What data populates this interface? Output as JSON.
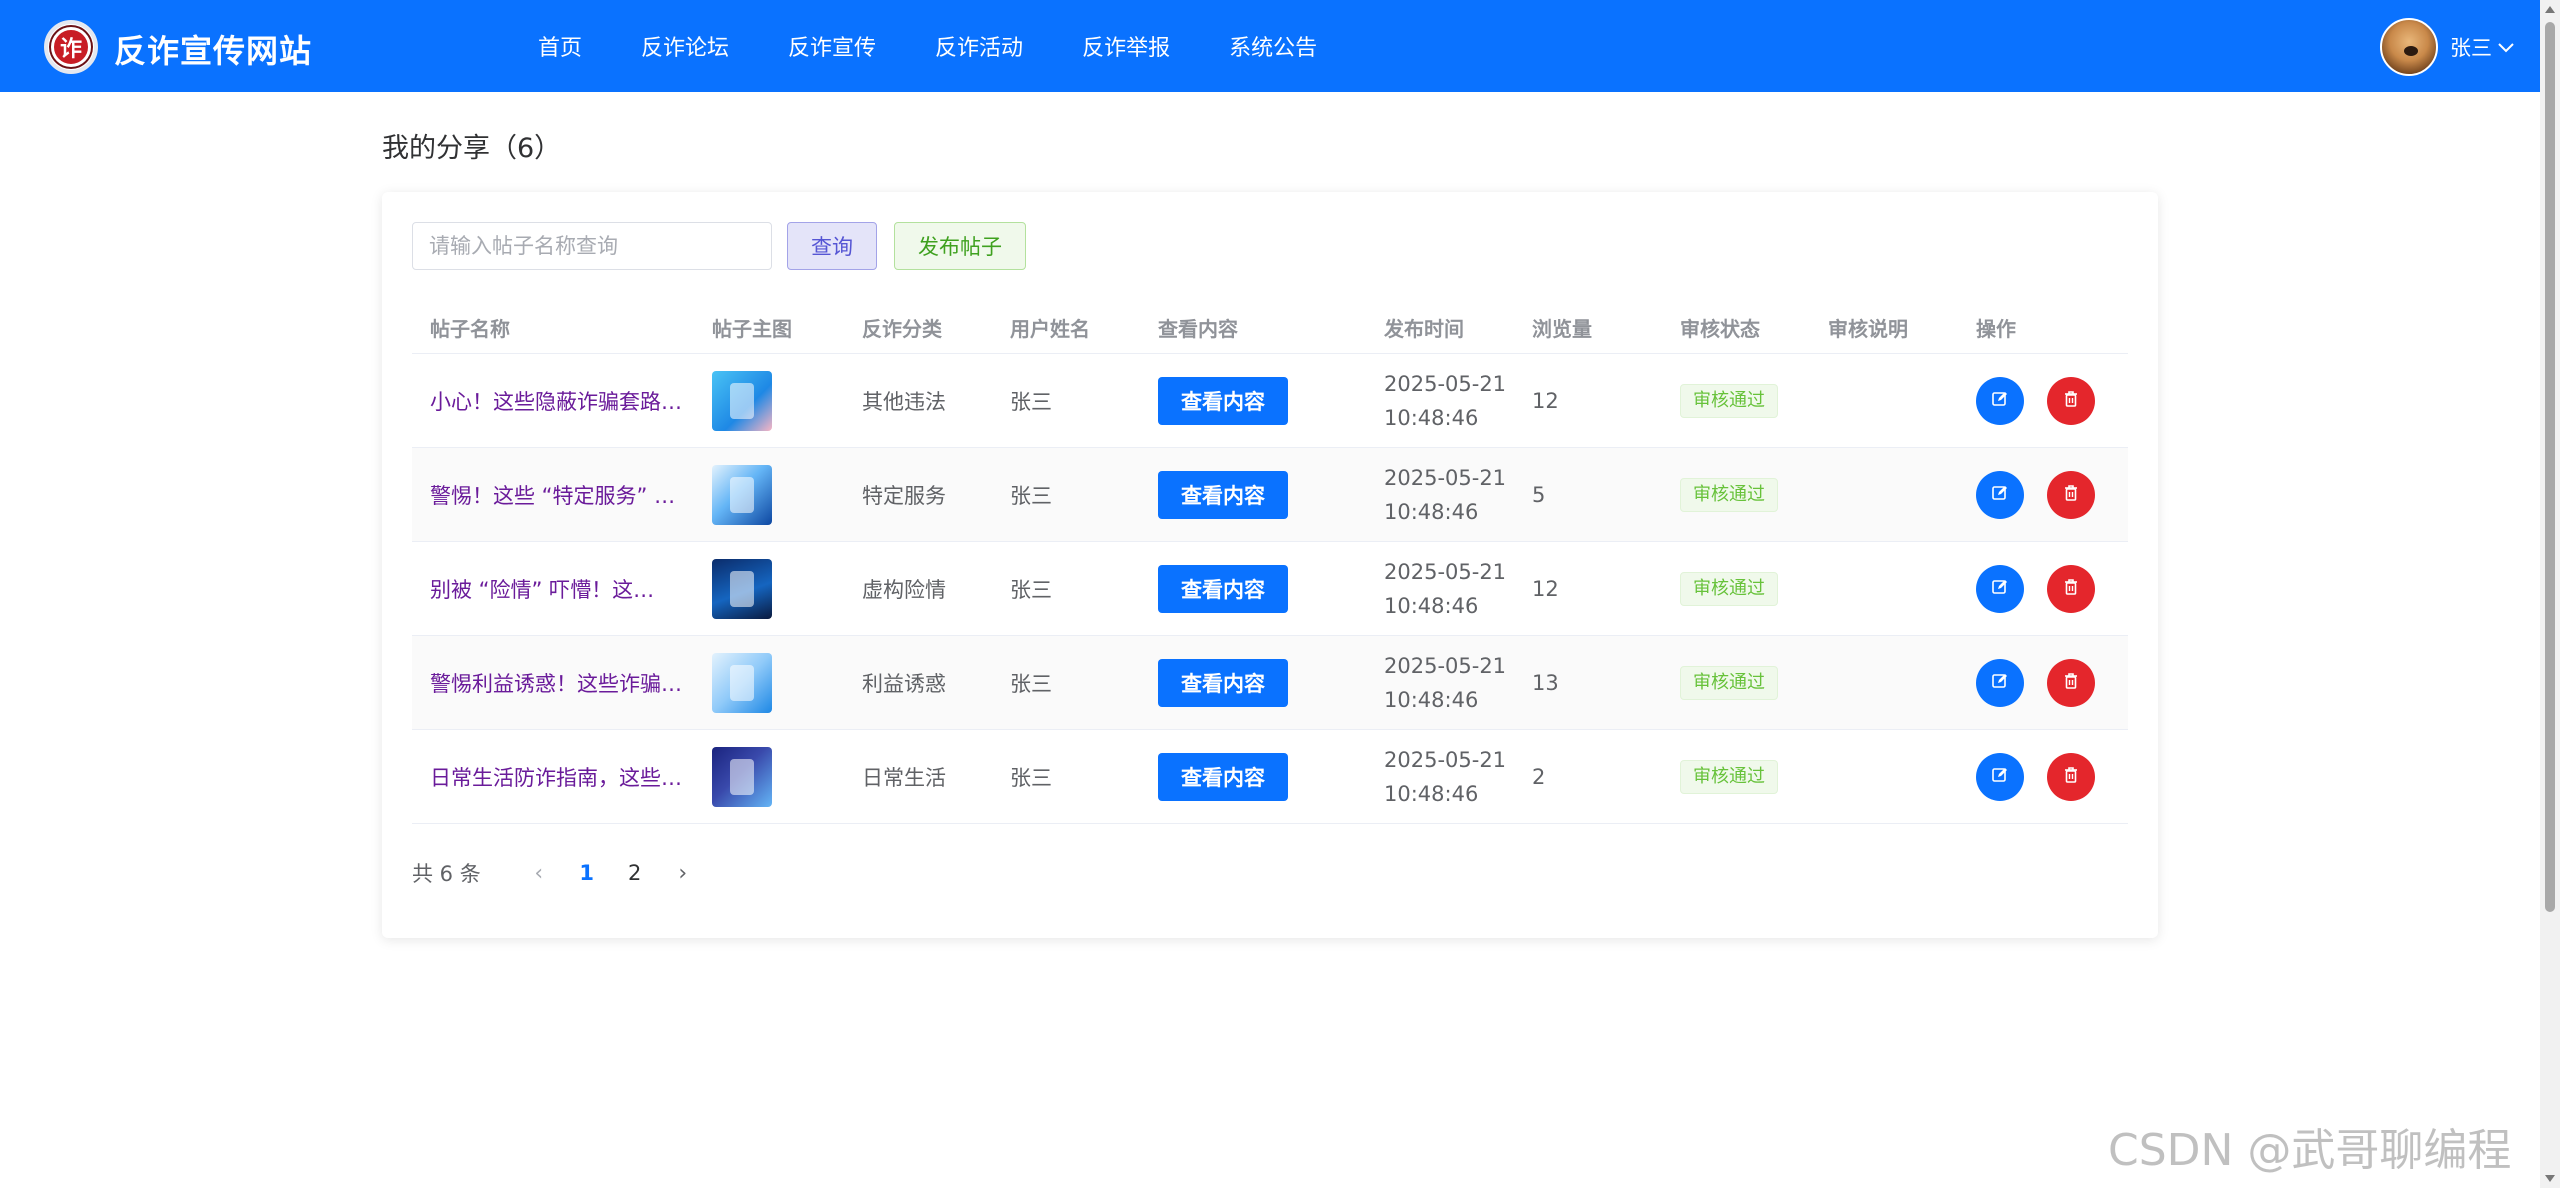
{
  "header": {
    "logo_char": "诈",
    "site_title": "反诈宣传网站",
    "nav": [
      "首页",
      "反诈论坛",
      "反诈宣传",
      "反诈活动",
      "反诈举报",
      "系统公告"
    ],
    "user_name": "张三"
  },
  "page": {
    "title": "我的分享（6）"
  },
  "toolbar": {
    "search_placeholder": "请输入帖子名称查询",
    "search_value": "",
    "query_label": "查询",
    "publish_label": "发布帖子"
  },
  "table": {
    "columns": [
      "帖子名称",
      "帖子主图",
      "反诈分类",
      "用户姓名",
      "查看内容",
      "发布时间",
      "浏览量",
      "审核状态",
      "审核说明",
      "操作"
    ],
    "view_label": "查看内容",
    "rows": [
      {
        "name": "小心！这些隐蔽诈骗套路…",
        "category": "其他违法",
        "user": "张三",
        "date": "2025-05-21",
        "time": "10:48:46",
        "views": "12",
        "status": "审核通过",
        "note": "",
        "thumb": "t1"
      },
      {
        "name": "警惕！这些 “特定服务” …",
        "category": "特定服务",
        "user": "张三",
        "date": "2025-05-21",
        "time": "10:48:46",
        "views": "5",
        "status": "审核通过",
        "note": "",
        "thumb": "t2"
      },
      {
        "name": "别被 “险情” 吓懵！这…",
        "category": "虚构险情",
        "user": "张三",
        "date": "2025-05-21",
        "time": "10:48:46",
        "views": "12",
        "status": "审核通过",
        "note": "",
        "thumb": "t3"
      },
      {
        "name": "警惕利益诱惑！这些诈骗…",
        "category": "利益诱惑",
        "user": "张三",
        "date": "2025-05-21",
        "time": "10:48:46",
        "views": "13",
        "status": "审核通过",
        "note": "",
        "thumb": "t4"
      },
      {
        "name": "日常生活防诈指南，这些…",
        "category": "日常生活",
        "user": "张三",
        "date": "2025-05-21",
        "time": "10:48:46",
        "views": "2",
        "status": "审核通过",
        "note": "",
        "thumb": "t5"
      }
    ]
  },
  "pagination": {
    "total_label": "共 6 条",
    "pages": [
      "1",
      "2"
    ],
    "current": "1"
  },
  "watermark": "CSDN @武哥聊编程",
  "colors": {
    "primary": "#0a72ff",
    "danger": "#e4262c",
    "success_tag": "#67c23a"
  },
  "icons": {
    "edit": "edit-icon",
    "delete": "trash-icon",
    "dropdown": "chevron-down-icon",
    "prev": "chevron-left-icon",
    "next": "chevron-right-icon"
  }
}
